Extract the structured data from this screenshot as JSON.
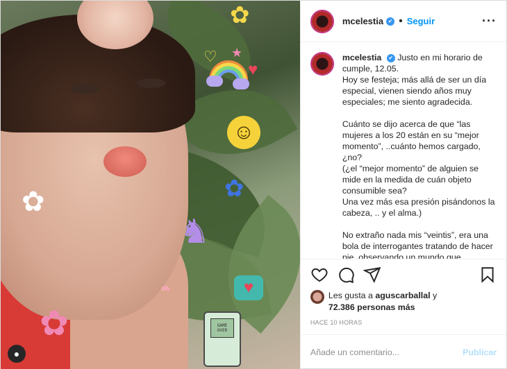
{
  "post": {
    "username": "mcelestia",
    "follow_label": "Seguir",
    "more_label": "···",
    "caption_paragraphs": [
      "Justo en mi horario de cumple, 12.05.\nHoy se festeja; más allá de ser un día especial, vienen siendo años muy especiales; me siento agradecida.",
      "Cuánto se dijo acerca de que “las mujeres a los 20 están en su “mejor momento”, ..cuánto hemos cargado, ¿no?\n(¿el “mejor momento” de alguien se mide en la medida de cuán objeto consumible sea?\nUna vez más esa presión pisándonos la cabeza, .. y el alma.)",
      "No extraño nada mis “veintis”, era una bola de interrogantes tratando de hacer pie, observando un mundo que"
    ],
    "likes": {
      "prefix": "Les gusta a",
      "first_user": "aguscarballal",
      "joiner": "y",
      "others": "72.386 personas más"
    },
    "timestamp": "HACE 10 HORAS",
    "comment": {
      "placeholder": "Añade un comentario...",
      "value": "",
      "publish_label": "Publicar"
    }
  },
  "photo": {
    "gameboy_text": "GAME OVER"
  },
  "icons": [
    "heart-icon",
    "comment-icon",
    "share-icon",
    "bookmark-icon",
    "verified-icon",
    "more-icon",
    "user-tag-icon"
  ],
  "colors": {
    "accent": "#0095f6",
    "verified": "#3897f0",
    "muted": "#8e8e8e",
    "publish_disabled": "#b2dffc"
  }
}
